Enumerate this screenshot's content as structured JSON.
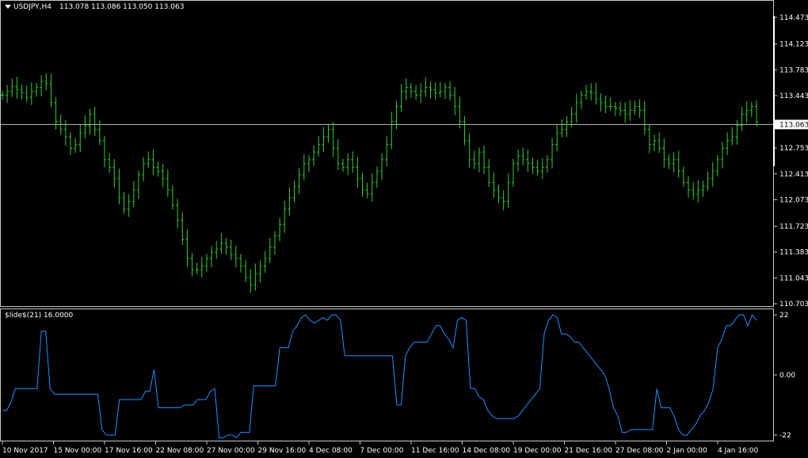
{
  "chart_header": {
    "symbol": "USDJPY,H4",
    "ohlc": "113.078 113.086 113.050 113.063"
  },
  "indicator_header": "$lide$(21) 16.0000",
  "colors": {
    "background": "#000000",
    "bars": "#32cd32",
    "indicator": "#1e90ff",
    "grid_line": "#c0c0c0",
    "price_tag_bg": "#ffffff"
  },
  "current_price": "113.063",
  "price_axis": [
    "114.473",
    "114.123",
    "113.783",
    "113.443",
    "113.063",
    "112.753",
    "112.413",
    "112.073",
    "111.723",
    "111.383",
    "111.043",
    "110.703"
  ],
  "indicator_axis": [
    "22",
    "0.00",
    "-22"
  ],
  "time_axis": [
    "10 Nov 2017",
    "15 Nov 00:00",
    "17 Nov 16:00",
    "22 Nov 08:00",
    "27 Nov 00:00",
    "29 Nov 16:00",
    "4 Dec 08:00",
    "7 Dec 00:00",
    "11 Dec 16:00",
    "14 Dec 08:00",
    "19 Dec 00:00",
    "21 Dec 16:00",
    "27 Dec 08:00",
    "2 Jan 00:00",
    "4 Jan 16:00"
  ],
  "chart_data": {
    "type": "line",
    "price_series": [
      113.45,
      113.5,
      113.56,
      113.52,
      113.48,
      113.42,
      113.5,
      113.55,
      113.63,
      113.6,
      113.35,
      113.1,
      113.0,
      112.9,
      112.75,
      112.8,
      112.95,
      113.05,
      113.2,
      113.0,
      112.85,
      112.6,
      112.5,
      112.35,
      112.1,
      111.95,
      112.05,
      112.2,
      112.4,
      112.55,
      112.6,
      112.5,
      112.45,
      112.35,
      112.2,
      112.0,
      111.8,
      111.55,
      111.3,
      111.15,
      111.15,
      111.2,
      111.3,
      111.38,
      111.42,
      111.5,
      111.45,
      111.35,
      111.3,
      111.2,
      111.05,
      110.95,
      111.1,
      111.2,
      111.3,
      111.45,
      111.6,
      111.75,
      111.95,
      112.1,
      112.25,
      112.4,
      112.55,
      112.6,
      112.7,
      112.8,
      112.9,
      113.0,
      112.75,
      112.55,
      112.5,
      112.6,
      112.5,
      112.35,
      112.2,
      112.15,
      112.3,
      112.45,
      112.6,
      112.8,
      113.1,
      113.3,
      113.5,
      113.55,
      113.5,
      113.45,
      113.5,
      113.55,
      113.52,
      113.48,
      113.5,
      113.55,
      113.45,
      113.3,
      113.1,
      112.85,
      112.6,
      112.55,
      112.7,
      112.5,
      112.3,
      112.2,
      112.1,
      112.05,
      112.3,
      112.55,
      112.65,
      112.6,
      112.55,
      112.5,
      112.45,
      112.5,
      112.6,
      112.8,
      112.95,
      113.0,
      113.1,
      113.2,
      113.35,
      113.45,
      113.5,
      113.48,
      113.4,
      113.35,
      113.3,
      113.3,
      113.28,
      113.25,
      113.2,
      113.25,
      113.3,
      113.25,
      113.0,
      112.8,
      112.85,
      112.75,
      112.6,
      112.55,
      112.6,
      112.45,
      112.3,
      112.2,
      112.15,
      112.2,
      112.25,
      112.35,
      112.45,
      112.6,
      112.75,
      112.85,
      112.9,
      113.05,
      113.2,
      113.25,
      113.3,
      113.1
    ],
    "indicator_series": [
      -13,
      -13,
      -10,
      -5,
      -5,
      -5,
      -5,
      -5,
      -5,
      16,
      16,
      -5,
      -7,
      -7,
      -7,
      -7,
      -7,
      -7,
      -7,
      -7,
      -7,
      -7,
      -7,
      -20,
      -22,
      -22,
      -22,
      -9,
      -9,
      -9,
      -9,
      -9,
      -9,
      -6,
      -6,
      2,
      -12,
      -12,
      -12,
      -12,
      -12,
      -12,
      -11,
      -11,
      -11,
      -9,
      -9,
      -9,
      -6,
      -5,
      -23,
      -23,
      -22,
      -22,
      -23,
      -21,
      -21,
      -21,
      -4,
      -4,
      -4,
      -4,
      -4,
      -4,
      10,
      10,
      10,
      16,
      18,
      21,
      22,
      20,
      19,
      20,
      21,
      20,
      22,
      22,
      20,
      7,
      7,
      7,
      7,
      7,
      7,
      7,
      7,
      7,
      7,
      7,
      7,
      -11,
      -11,
      7,
      10,
      12,
      12,
      12,
      12,
      15,
      18,
      18,
      15,
      13,
      10,
      20,
      21,
      20,
      -5,
      -5,
      -8,
      -9,
      -13,
      -15,
      -16,
      -16,
      -16,
      -16,
      -16,
      -15,
      -13,
      -11,
      -9,
      -7,
      -5,
      15,
      20,
      22,
      21,
      15,
      15,
      14,
      12,
      12,
      10,
      8,
      6,
      4,
      2,
      0,
      -5,
      -12,
      -15,
      -21,
      -21,
      -20,
      -20,
      -20,
      -20,
      -20,
      -20,
      -5,
      -12,
      -12,
      -12,
      -15,
      -20,
      -22,
      -22,
      -20,
      -18,
      -15,
      -13,
      -10,
      -5,
      10,
      13,
      18,
      18,
      20,
      22,
      22,
      18,
      22,
      20
    ],
    "price_ylim": [
      110.703,
      114.473
    ],
    "indicator_ylim": [
      -22,
      22
    ],
    "indicator_levels": [
      22,
      0,
      -22
    ]
  }
}
